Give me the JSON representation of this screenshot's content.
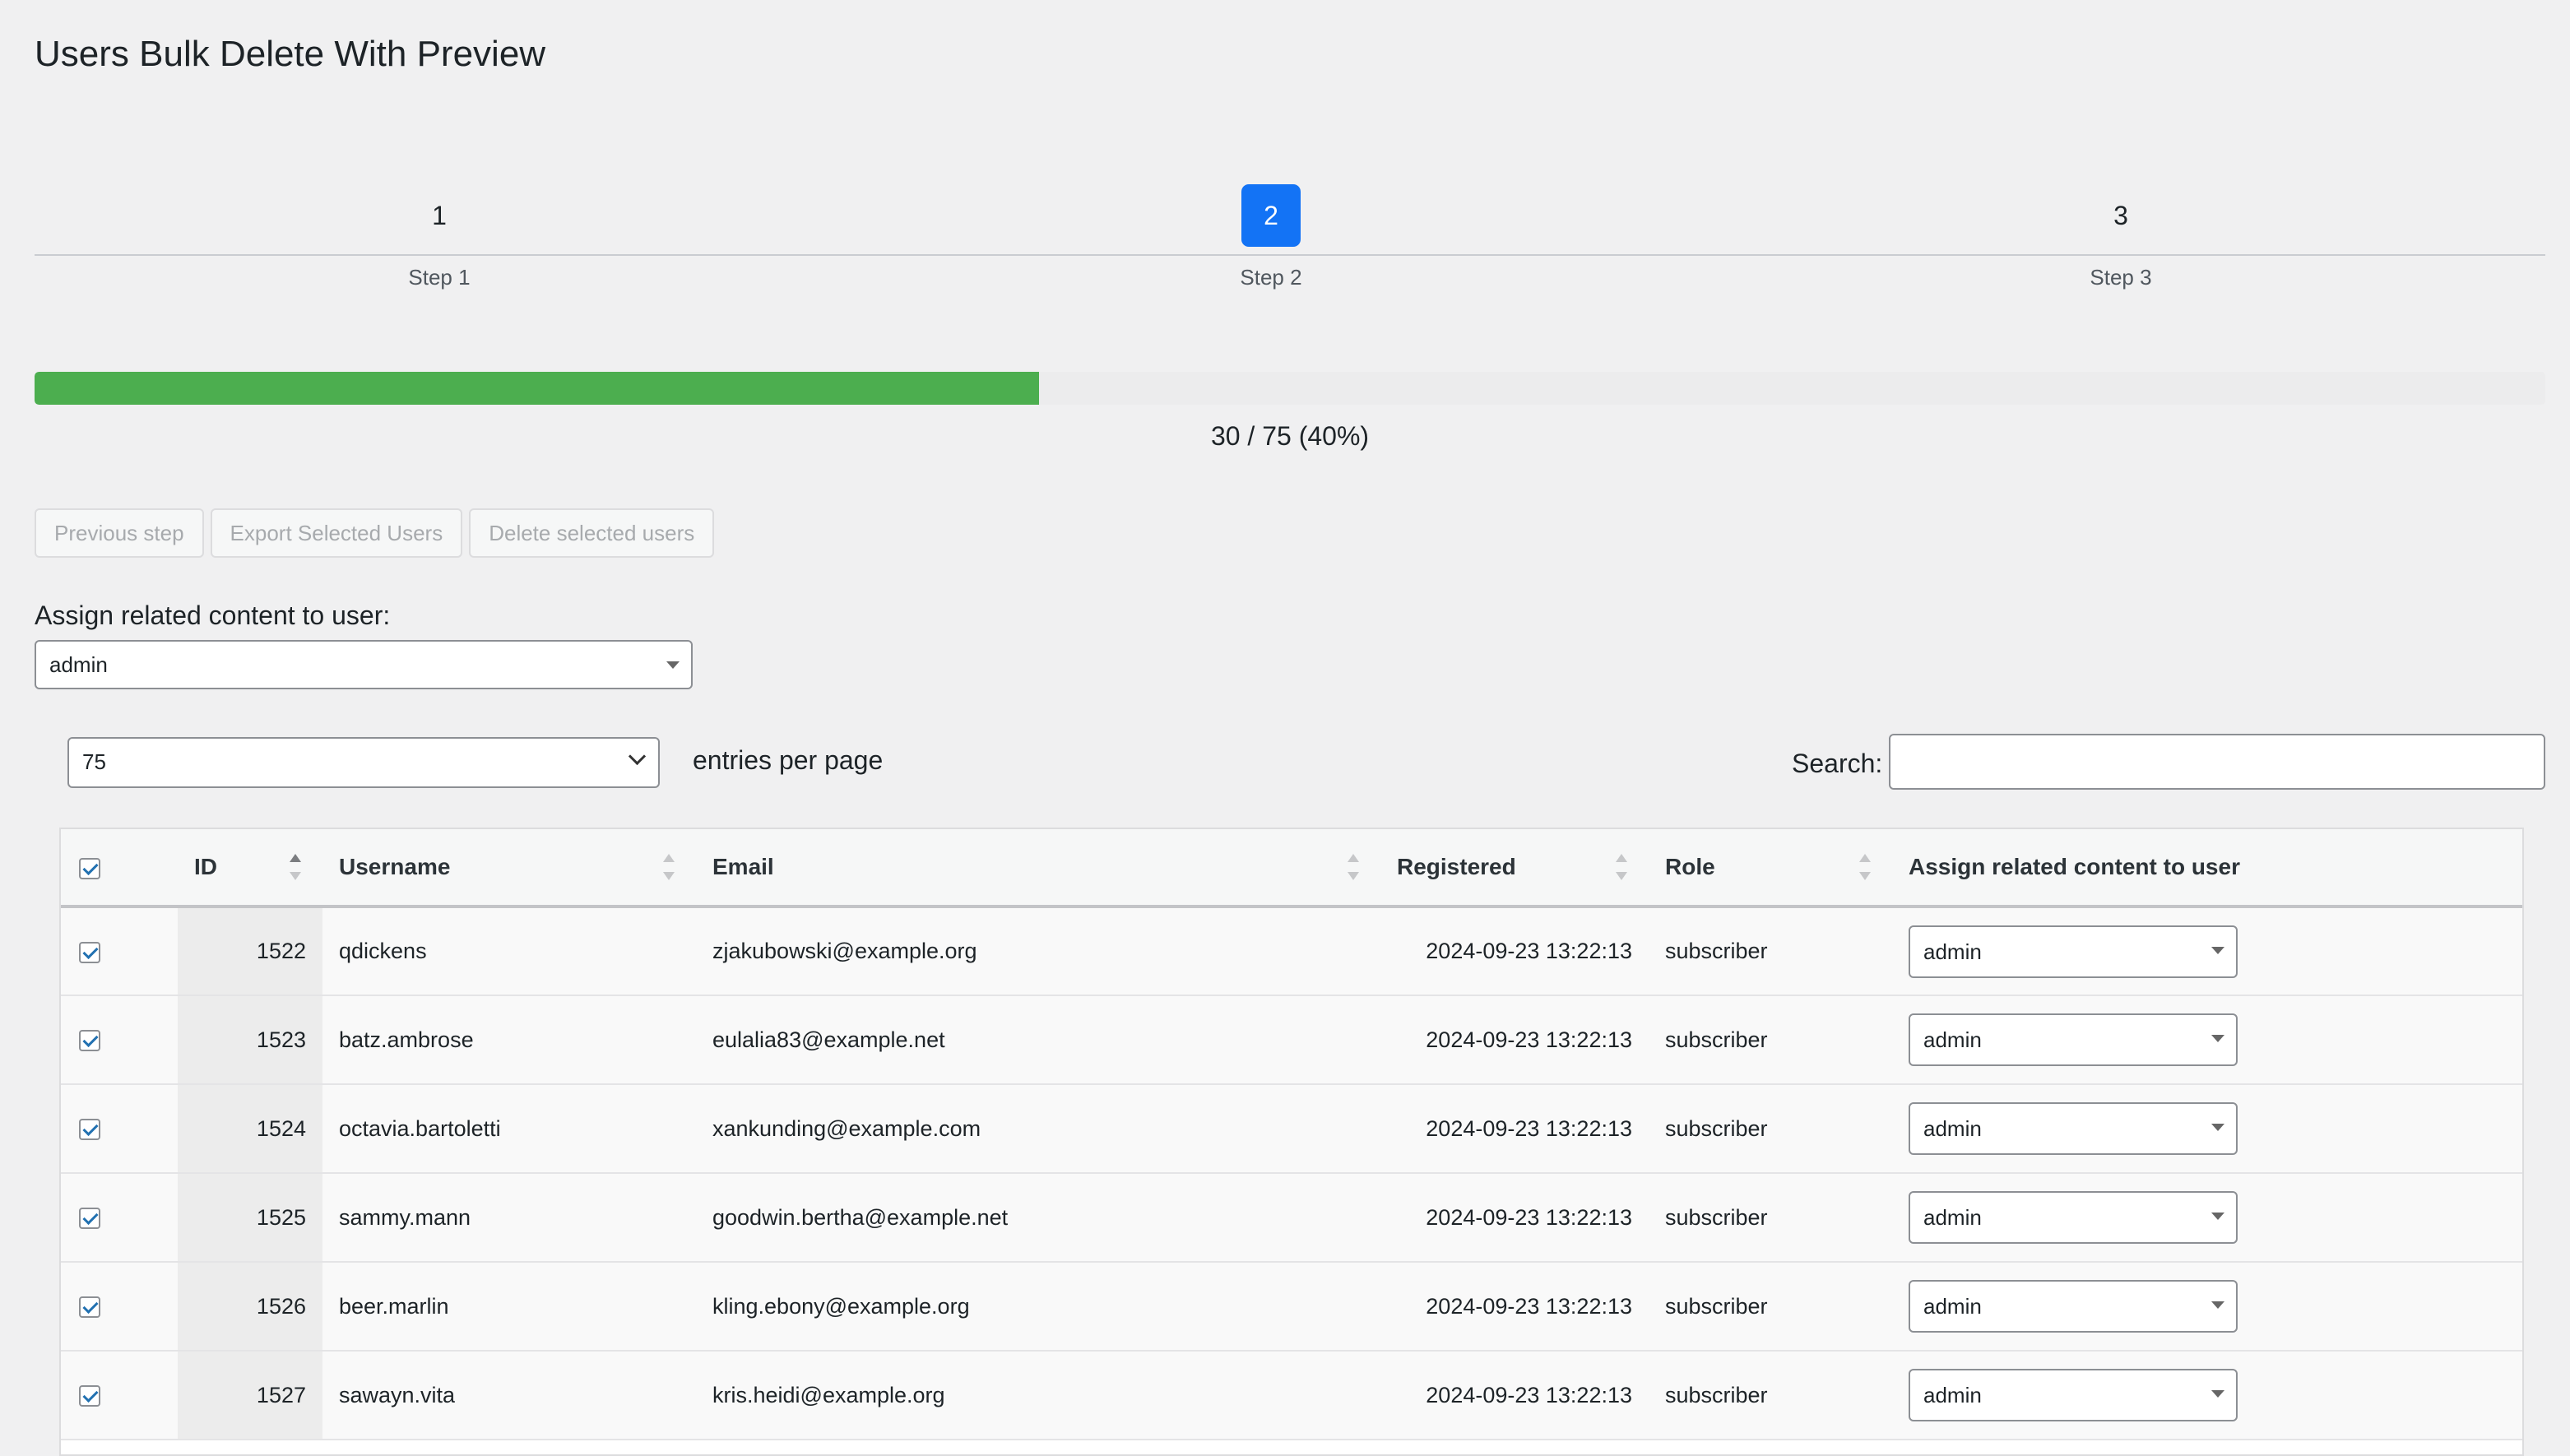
{
  "page": {
    "title": "Users Bulk Delete With Preview"
  },
  "stepper": {
    "steps": [
      {
        "number": "1",
        "label": "Step 1",
        "active": false
      },
      {
        "number": "2",
        "label": "Step 2",
        "active": true
      },
      {
        "number": "3",
        "label": "Step 3",
        "active": false
      }
    ]
  },
  "progress": {
    "current": 30,
    "total": 75,
    "percent": 40,
    "text": "30 / 75 (40%)",
    "fill_color": "#4cae4f"
  },
  "actions": {
    "previous_label": "Previous step",
    "export_label": "Export Selected Users",
    "delete_label": "Delete selected users"
  },
  "assign": {
    "label": "Assign related content to user:",
    "value": "admin"
  },
  "table_controls": {
    "per_page_value": "75",
    "per_page_label": "entries per page",
    "search_label": "Search:",
    "search_value": ""
  },
  "table": {
    "headers": {
      "id": "ID",
      "username": "Username",
      "email": "Email",
      "registered": "Registered",
      "role": "Role",
      "assign": "Assign related content to user"
    },
    "rows": [
      {
        "id": "1522",
        "username": "qdickens",
        "email": "zjakubowski@example.org",
        "registered": "2024-09-23 13:22:13",
        "role": "subscriber",
        "assign": "admin"
      },
      {
        "id": "1523",
        "username": "batz.ambrose",
        "email": "eulalia83@example.net",
        "registered": "2024-09-23 13:22:13",
        "role": "subscriber",
        "assign": "admin"
      },
      {
        "id": "1524",
        "username": "octavia.bartoletti",
        "email": "xankunding@example.com",
        "registered": "2024-09-23 13:22:13",
        "role": "subscriber",
        "assign": "admin"
      },
      {
        "id": "1525",
        "username": "sammy.mann",
        "email": "goodwin.bertha@example.net",
        "registered": "2024-09-23 13:22:13",
        "role": "subscriber",
        "assign": "admin"
      },
      {
        "id": "1526",
        "username": "beer.marlin",
        "email": "kling.ebony@example.org",
        "registered": "2024-09-23 13:22:13",
        "role": "subscriber",
        "assign": "admin"
      },
      {
        "id": "1527",
        "username": "sawayn.vita",
        "email": "kris.heidi@example.org",
        "registered": "2024-09-23 13:22:13",
        "role": "subscriber",
        "assign": "admin"
      }
    ]
  }
}
